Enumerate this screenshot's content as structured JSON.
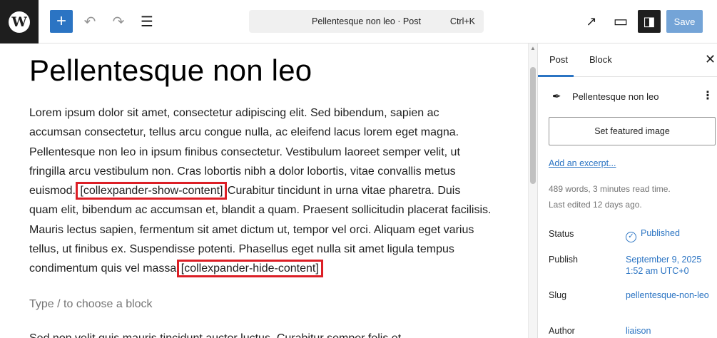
{
  "toolbar": {
    "logo_glyph": "W",
    "add_glyph": "+",
    "undo_glyph": "↶",
    "redo_glyph": "↷",
    "list_glyph": "☰",
    "command_title": "Pellentesque non leo · Post",
    "command_shortcut": "Ctrl+K",
    "view_glyph": "↗",
    "device_glyph": "▭",
    "settings_glyph": "◨",
    "save_label": "Save"
  },
  "editor": {
    "title": "Pellentesque non leo",
    "paragraph": {
      "part1": "Lorem ipsum dolor sit amet, consectetur adipiscing elit. Sed bibendum, sapien ac accumsan consectetur, tellus arcu congue nulla, ac eleifend lacus lorem eget magna. Pellentesque non leo in ipsum finibus consectetur. Vestibulum laoreet semper velit, ut fringilla arcu vestibulum non. Cras lobortis nibh a dolor lobortis, vitae convallis metus euismod. ",
      "shortcode_show": "[collexpander-show-content]",
      "part2": " Curabitur tincidunt in urna vitae pharetra. Duis quam elit, bibendum ac accumsan et, blandit a quam. Praesent sollicitudin placerat facilisis. Mauris lectus sapien, fermentum sit amet dictum ut, tempor vel orci. Aliquam eget varius tellus, ut finibus ex. Suspendisse potenti. Phasellus eget nulla sit amet ligula tempus condimentum quis vel massa ",
      "shortcode_hide": "[collexpander-hide-content]"
    },
    "placeholder": "Type / to choose a block",
    "next_paragraph": "Sed non velit quis mauris tincidunt auctor luctus. Curabitur semper felis et"
  },
  "sidebar": {
    "tab_post": "Post",
    "tab_block": "Block",
    "close_glyph": "✕",
    "post_icon": "✒",
    "post_title": "Pellentesque non leo",
    "kebab_glyph": "⋮",
    "featured_image_label": "Set featured image",
    "excerpt_link": "Add an excerpt...",
    "reading_info": "489 words, 3 minutes read time.",
    "last_edited": "Last edited 12 days ago.",
    "status_label": "Status",
    "status_value": "Published",
    "status_icon": "✓",
    "publish_label": "Publish",
    "publish_value": "September 9, 2025 1:52 am UTC+0",
    "slug_label": "Slug",
    "slug_value": "pellentesque-non-leo",
    "author_label": "Author",
    "author_value": "liaison"
  },
  "colors": {
    "accent": "#2b74c3",
    "highlight_box": "#dc1f26",
    "topbar_dark": "#1e1e1e"
  }
}
